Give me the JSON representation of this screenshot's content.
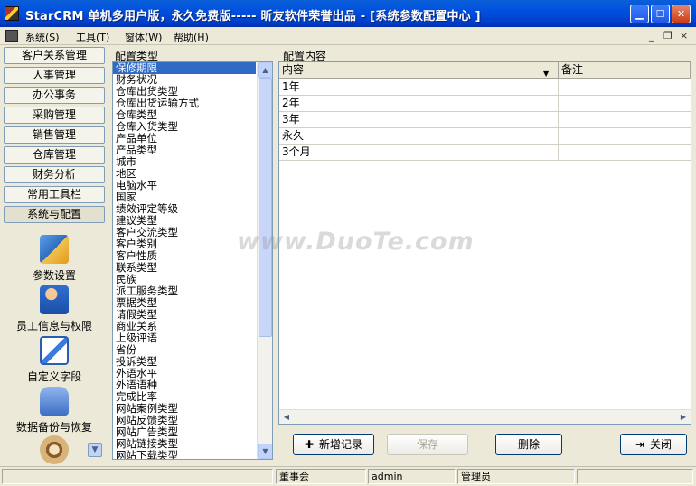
{
  "window": {
    "title": "StarCRM 单机多用户版，永久免费版----- 昕友软件荣誉出品  - [系统参数配置中心  ]"
  },
  "menu": [
    "系统(S)",
    "工具(T)",
    "窗体(W)",
    "帮助(H)"
  ],
  "mdi_controls": [
    "_",
    "❐",
    "×"
  ],
  "nav": {
    "buttons": [
      "客户关系管理",
      "人事管理",
      "办公事务",
      "采购管理",
      "销售管理",
      "仓库管理",
      "财务分析",
      "常用工具栏",
      "系统与配置"
    ],
    "tools": [
      {
        "label": "参数设置",
        "icon": "settings-icon"
      },
      {
        "label": "员工信息与权限",
        "icon": "user-permission-icon"
      },
      {
        "label": "自定义字段",
        "icon": "custom-field-icon"
      },
      {
        "label": "数据备份与恢复",
        "icon": "database-backup-icon"
      }
    ]
  },
  "config_types": {
    "title": "配置类型",
    "selected": "保修期限",
    "items": [
      "保修期限",
      "财务状况",
      "仓库出货类型",
      "仓库出货运输方式",
      "仓库类型",
      "仓库入货类型",
      "产品单位",
      "产品类型",
      "城市",
      "地区",
      "电脑水平",
      "国家",
      "绩效评定等级",
      "建议类型",
      "客户交流类型",
      "客户类别",
      "客户性质",
      "联系类型",
      "民族",
      "派工服务类型",
      "票据类型",
      "请假类型",
      "商业关系",
      "上级评语",
      "省份",
      "投诉类型",
      "外语水平",
      "外语语种",
      "完成比率",
      "网站案例类型",
      "网站反馈类型",
      "网站广告类型",
      "网站链接类型",
      "网站下载类型"
    ]
  },
  "config_content": {
    "title": "配置内容",
    "columns": [
      "内容",
      "备注"
    ],
    "rows": [
      [
        "1年",
        ""
      ],
      [
        "2年",
        ""
      ],
      [
        "3年",
        ""
      ],
      [
        "永久",
        ""
      ],
      [
        "3个月",
        ""
      ]
    ]
  },
  "buttons": {
    "add": "新增记录",
    "save": "保存",
    "delete": "删除",
    "close": "关闭"
  },
  "statusbar": [
    "",
    "董事会",
    "admin",
    "管理员",
    ""
  ],
  "watermark": "www.DuoTe.com",
  "colors": {
    "selection": "#316AC5",
    "titlebar": "#0054E3"
  }
}
